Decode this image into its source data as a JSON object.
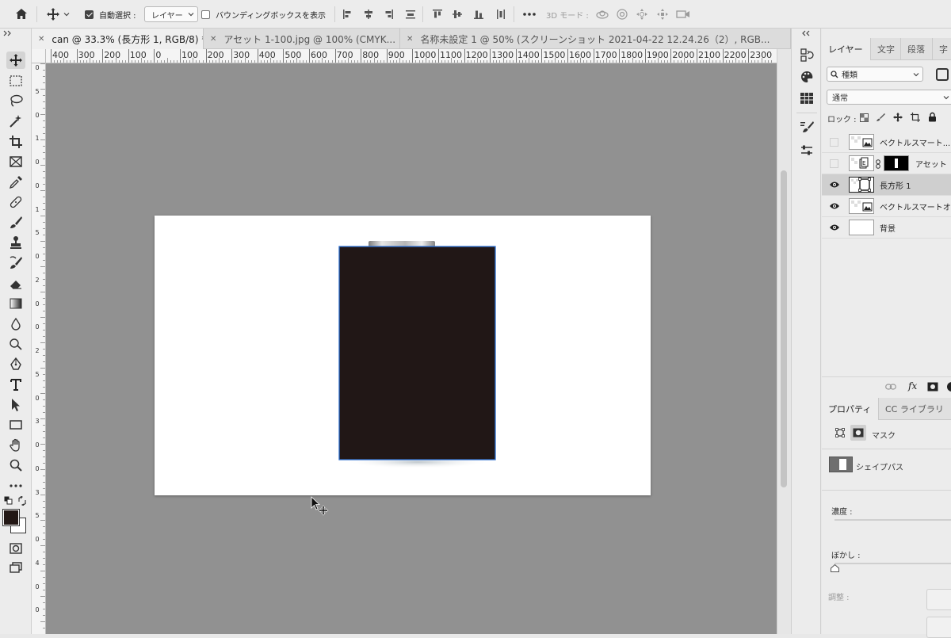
{
  "options_bar": {
    "auto_select_label": "自動選択 :",
    "auto_select_value": "レイヤー",
    "bounding_box_label": "バウンディングボックスを表示",
    "mode_3d_label": "3D モード :"
  },
  "tabs": [
    {
      "label": "can @ 33.3% (長方形 1, RGB/8) *"
    },
    {
      "label": "アセット 1-100.jpg @ 100% (CMYK..."
    },
    {
      "label": "名称未設定 1 @ 50% (スクリーンショット 2021-04-22 12.24.26（2）, RGB..."
    }
  ],
  "ruler": {
    "h_ticks": [
      "400",
      "300",
      "200",
      "100",
      "0",
      "100",
      "200",
      "300",
      "400",
      "500",
      "600",
      "700",
      "800",
      "900",
      "1000",
      "1100",
      "1200",
      "1300",
      "1400",
      "1500",
      "1600",
      "1700",
      "1800",
      "1900",
      "2000",
      "2100",
      "2200",
      "2300"
    ],
    "v_ticks": [
      "0",
      "5",
      "0",
      "1",
      "0",
      "0",
      "1",
      "5",
      "0",
      "2",
      "0",
      "0",
      "2",
      "5",
      "0",
      "3",
      "0",
      "0",
      "3",
      "5",
      "0",
      "4",
      "0",
      "0"
    ]
  },
  "layers_panel": {
    "tabs": [
      {
        "label": "レイヤー"
      },
      {
        "label": "文字"
      },
      {
        "label": "段落"
      },
      {
        "label": "字"
      }
    ],
    "filter_value": "種類",
    "blend_mode": "通常",
    "lock_label": "ロック :",
    "layers": [
      {
        "name": "ベクトルスマート...",
        "visible": false,
        "selected": false
      },
      {
        "name": "アセット",
        "visible": false,
        "selected": false
      },
      {
        "name": "長方形 1",
        "visible": true,
        "selected": true
      },
      {
        "name": "ベクトルスマートオ",
        "visible": true,
        "selected": false
      },
      {
        "name": "背景",
        "visible": true,
        "selected": false
      }
    ]
  },
  "properties_panel": {
    "tabs": [
      {
        "label": "プロパティ"
      },
      {
        "label": "CC ライブラリ"
      }
    ],
    "mask_label": "マスク",
    "shape_path_label": "シェイプパス",
    "density_label": "濃度 :",
    "feather_label": "ぼかし :",
    "adjust_label": "調整 :"
  },
  "colors": {
    "foreground": "#231815",
    "can_body": "#211716",
    "selection_outline": "#2d6fd1",
    "workspace": "#919191"
  }
}
